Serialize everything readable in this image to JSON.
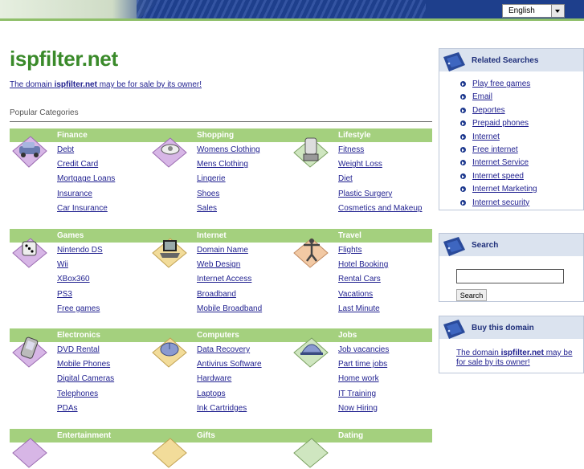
{
  "header": {
    "language": "English"
  },
  "site": {
    "title": "ispfilter.net",
    "sale_prefix": "The domain ",
    "sale_domain": "ispfilter.net",
    "sale_suffix": " may be for sale by its owner!",
    "popular_label": "Popular Categories"
  },
  "categories": [
    {
      "title": "Finance",
      "icon": "car-icon",
      "links": [
        "Debt",
        "Credit Card",
        "Mortgage Loans",
        "Insurance",
        "Car Insurance"
      ]
    },
    {
      "title": "Shopping",
      "icon": "shopping-icon",
      "links": [
        "Womens Clothing",
        "Mens Clothing",
        "Lingerie",
        "Shoes",
        "Sales"
      ]
    },
    {
      "title": "Lifestyle",
      "icon": "blender-icon",
      "links": [
        "Fitness",
        "Weight Loss",
        "Diet",
        "Plastic Surgery",
        "Cosmetics and Makeup"
      ]
    },
    {
      "title": "Games",
      "icon": "dice-icon",
      "links": [
        "Nintendo DS",
        "Wii",
        "XBox360",
        "PS3",
        "Free games"
      ]
    },
    {
      "title": "Internet",
      "icon": "laptop-icon",
      "links": [
        "Domain Name",
        "Web Design",
        "Internet Access",
        "Broadband",
        "Mobile Broadband"
      ]
    },
    {
      "title": "Travel",
      "icon": "person-icon",
      "links": [
        "Flights",
        "Hotel Booking",
        "Rental Cars",
        "Vacations",
        "Last Minute"
      ]
    },
    {
      "title": "Electronics",
      "icon": "pda-icon",
      "links": [
        "DVD Rental",
        "Mobile Phones",
        "Digital Cameras",
        "Telephones",
        "PDAs"
      ]
    },
    {
      "title": "Computers",
      "icon": "mouse-icon",
      "links": [
        "Data Recovery",
        "Antivirus Software",
        "Hardware",
        "Laptops",
        "Ink Cartridges"
      ]
    },
    {
      "title": "Jobs",
      "icon": "helmet-icon",
      "links": [
        "Job vacancies",
        "Part time jobs",
        "Home work",
        "IT Training",
        "Now Hiring"
      ]
    },
    {
      "title": "Entertainment",
      "icon": "entertainment-icon",
      "links": []
    },
    {
      "title": "Gifts",
      "icon": "gift-icon",
      "links": []
    },
    {
      "title": "Dating",
      "icon": "dating-icon",
      "links": []
    }
  ],
  "sidebar": {
    "related_title": "Related Searches",
    "related": [
      "Play free games",
      "Email",
      "Deportes",
      "Prepaid phones",
      "Internet",
      "Free internet",
      "Internet Service",
      "Internet speed",
      "Internet Marketing",
      "Internet security"
    ],
    "search_title": "Search",
    "search_button": "Search",
    "buy_title": "Buy this domain",
    "buy_prefix": "The domain ",
    "buy_domain": "ispfilter.net",
    "buy_suffix": " may be for sale by its owner!"
  }
}
